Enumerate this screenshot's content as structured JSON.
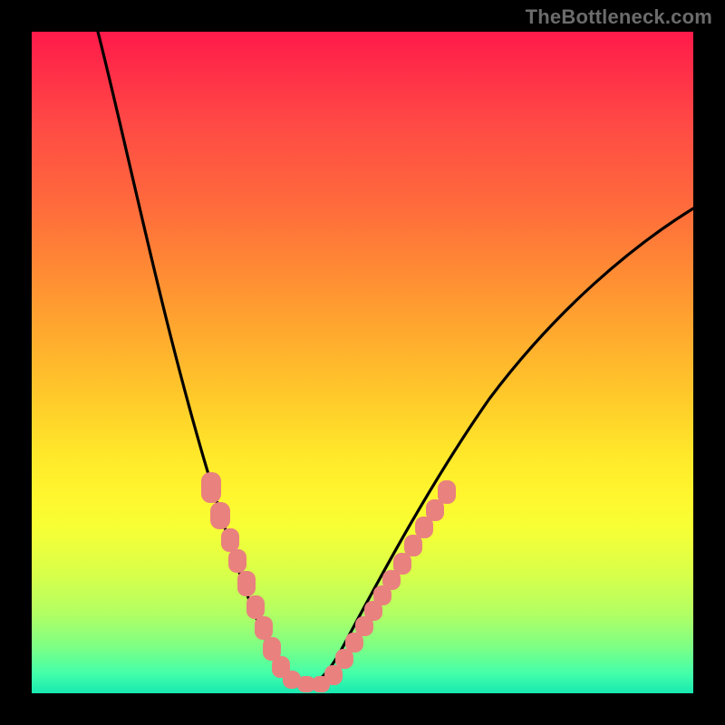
{
  "watermark": {
    "text": "TheBottleneck.com"
  },
  "chart_data": {
    "type": "line",
    "title": "",
    "xlabel": "",
    "ylabel": "",
    "xlim": [
      0,
      100
    ],
    "ylim": [
      0,
      100
    ],
    "series": [
      {
        "name": "bottleneck-curve",
        "x": [
          10,
          15,
          20,
          25,
          28,
          30,
          32,
          34,
          36,
          38,
          40,
          45,
          50,
          55,
          60,
          70,
          80,
          90,
          100
        ],
        "values": [
          100,
          80,
          60,
          42,
          30,
          20,
          10,
          3,
          0,
          0,
          3,
          12,
          22,
          30,
          38,
          50,
          58,
          64,
          70
        ]
      }
    ],
    "annotations": [
      {
        "name": "salmon-marker-cluster",
        "approx_x_range": [
          23,
          44
        ],
        "approx_y_range": [
          0,
          35
        ]
      }
    ],
    "gradient_stops": [
      {
        "pos": 0.0,
        "color": "#ff1a4a"
      },
      {
        "pos": 0.26,
        "color": "#ff6a3c"
      },
      {
        "pos": 0.56,
        "color": "#ffcc2a"
      },
      {
        "pos": 0.75,
        "color": "#f7ff35"
      },
      {
        "pos": 0.93,
        "color": "#7dff85"
      },
      {
        "pos": 1.0,
        "color": "#18e8b0"
      }
    ]
  }
}
